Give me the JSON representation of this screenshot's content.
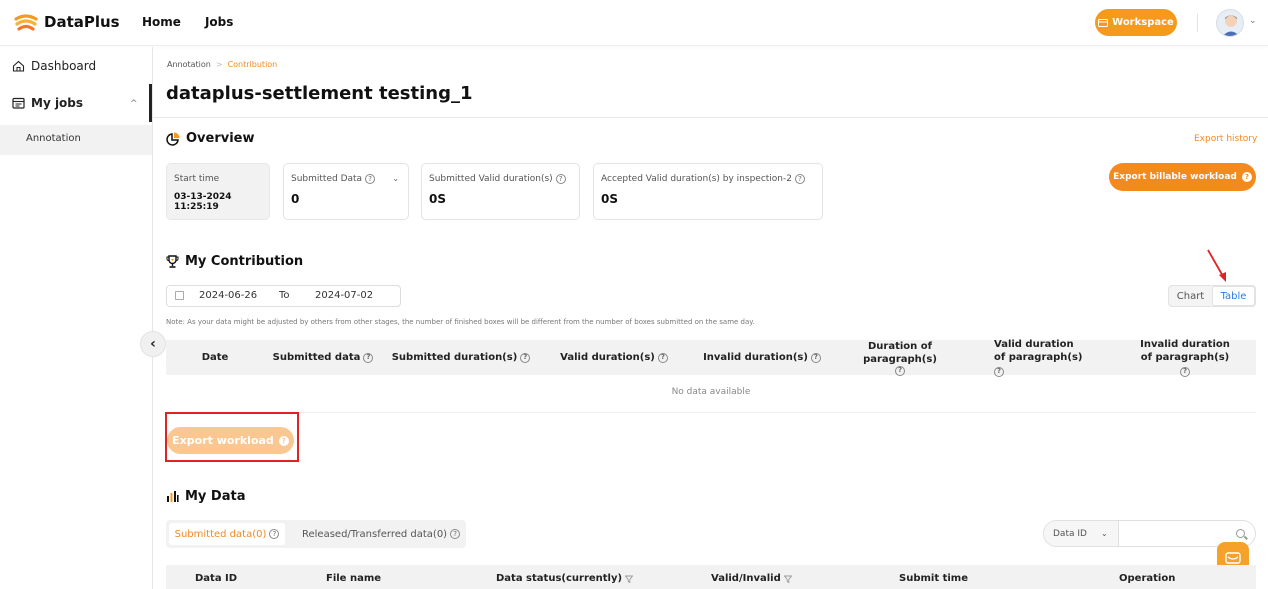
{
  "header": {
    "brand": "DataPlus",
    "nav": [
      "Home",
      "Jobs"
    ],
    "workspace_label": "Workspace",
    "colors": {
      "accent": "#f59a1c"
    }
  },
  "sidebar": {
    "dashboard": "Dashboard",
    "my_jobs": "My jobs",
    "annotation": "Annotation"
  },
  "breadcrumb": {
    "parent": "Annotation",
    "current": "Contribution"
  },
  "page_title": "dataplus-settlement testing_1",
  "overview": {
    "title": "Overview",
    "export_history": "Export history",
    "export_billable": "Export billable workload",
    "cards": {
      "start_time": {
        "label": "Start time",
        "value": "03-13-2024 11:25:19"
      },
      "submitted_data": {
        "label": "Submitted Data",
        "value": "0"
      },
      "submitted_valid": {
        "label": "Submitted Valid duration(s)",
        "value": "0S"
      },
      "accepted_valid": {
        "label": "Accepted Valid duration(s) by inspection-2",
        "value": "0S"
      }
    }
  },
  "contribution": {
    "title": "My Contribution",
    "date_from": "2024-06-26",
    "date_to_label": "To",
    "date_to": "2024-07-02",
    "view_chart": "Chart",
    "view_table": "Table",
    "note": "Note: As your data might be adjusted by others from other stages, the number of finished boxes will be different from the number of boxes submitted on the same day.",
    "columns": [
      "Date",
      "Submitted data",
      "Submitted duration(s)",
      "Valid duration(s)",
      "Invalid duration(s)",
      "Duration of paragraph(s)",
      "Valid duration of paragraph(s)",
      "Invalid duration of paragraph(s)"
    ],
    "empty": "No data available",
    "export_workload": "Export workload"
  },
  "my_data": {
    "title": "My Data",
    "tab_submitted": "Submitted data(0)",
    "tab_released": "Released/Transferred data(0)",
    "search_field": "Data ID",
    "columns": [
      "Data ID",
      "File name",
      "Data status(currently)",
      "Valid/Invalid",
      "Submit time",
      "Operation"
    ]
  }
}
